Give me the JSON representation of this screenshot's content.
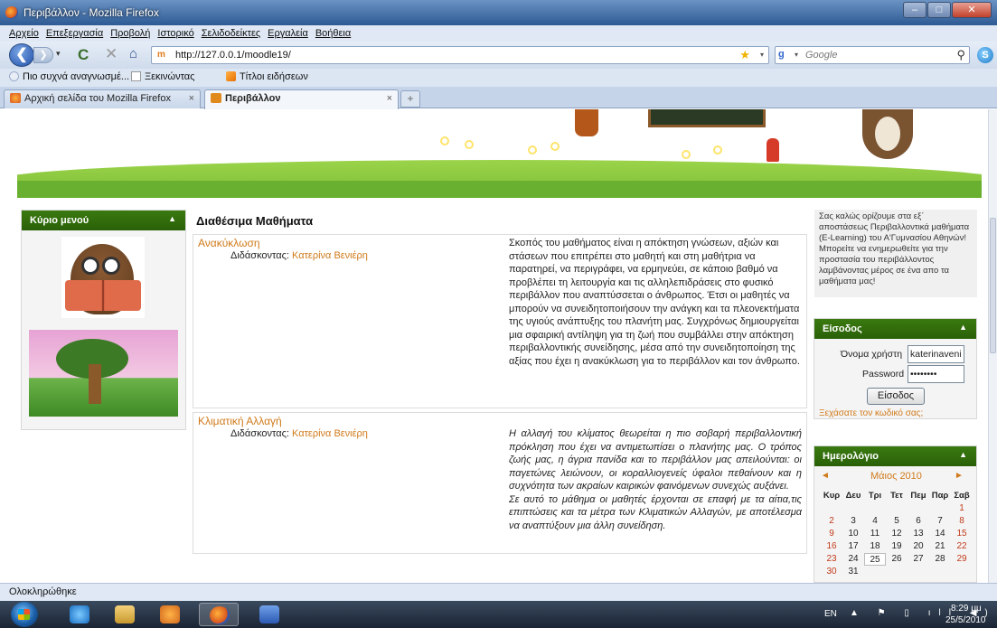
{
  "window": {
    "title": "Περιβάλλον - Mozilla Firefox",
    "buttons": {
      "minimize": "–",
      "maximize": "□",
      "close": "✕"
    }
  },
  "menu": [
    "Αρχείο",
    "Επεξεργασία",
    "Προβολή",
    "Ιστορικό",
    "Σελιδοδείκτες",
    "Εργαλεία",
    "Βοήθεια"
  ],
  "nav": {
    "back_glyph": "❮",
    "forward_glyph": "❯",
    "dropdown_glyph": "▾",
    "reload_glyph": "C",
    "stop_glyph": "✕",
    "home_glyph": "⌂",
    "url_favicon": "m",
    "url": "http://127.0.0.1/moodle19/",
    "star_glyph": "★",
    "url_dd_glyph": "▾",
    "search_engine_glyph": "g",
    "search_dd_glyph": "▾",
    "search_placeholder": "Google",
    "search_glyph": "⚲",
    "skype_glyph": "S"
  },
  "bookmarks": [
    "Πιο συχνά αναγνωσμέ...",
    "Ξεκινώντας",
    "Τίτλοι ειδήσεων"
  ],
  "tabs": [
    {
      "label": "Αρχική σελίδα του Mozilla Firefox",
      "close": "×"
    },
    {
      "label": "Περιβάλλον",
      "close": "×"
    }
  ],
  "new_tab_glyph": "+",
  "left_block": {
    "title": "Κύριο μενού",
    "collapse_glyph": "▲"
  },
  "main": {
    "title": "Διαθέσιμα Μαθήματα",
    "teacher_prefix": "Διδάσκοντας:",
    "courses": [
      {
        "name": "Ανακύκλωση",
        "teacher": "Κατερίνα Βενιέρη",
        "summary": "Σκοπός του μαθήματος είναι η απόκτηση γνώσεων, αξιών και στάσεων που επιτρέπει στο μαθητή και στη μαθήτρια να παρατηρεί, να περιγράφει, να ερμηνεύει, σε κάποιο βαθμό να προβλέπει τη λειτουργία και τις αλληλεπιδράσεις στο φυσικό περιβάλλον που αναπτύσσεται ο άνθρωπος. Έτσι οι μαθητές να μπορούν να συνειδητοποιήσουν την ανάγκη και τα πλεονεκτήματα της υγιούς ανάπτυξης του πλανήτη μας. Συγχρόνως δημιουργείται μια σφαιρική αντίληψη για τη ζωή που συμβάλλει στην απόκτηση περιβαλλοντικής συνείδησης, μέσα από την συνειδητοποίηση της αξίας που έχει η ανακύκλωση για το περιβάλλον και τον άνθρωπο."
      },
      {
        "name": "Κλιματική Αλλαγή",
        "teacher": "Κατερίνα Βενιέρη",
        "summary_p1": "Η αλλαγή του κλίματος θεωρείται η πιο σοβαρή περιβαλλοντική πρόκληση που έχει να αντιμετωπίσει ο πλανήτης μας. Ο τρόπος ζωής μας, η άγρια πανίδα και το περιβάλλον μας απειλούνται: οι παγετώνες λειώνουν, οι κοραλλιογενείς ύφαλοι πεθαίνουν και η συχνότητα των ακραίων καιρικών φαινόμενων συνεχώς αυξάνει.",
        "summary_p2": "Σε αυτό το μάθημα οι μαθητές έρχονται σε επαφή με τα αίτια,τις επιπτώσεις και τα μέτρα των Κλιματικών Αλλαγών, με αποτέλεσμα να αναπτύξουν μια άλλη συνείδηση."
      }
    ]
  },
  "welcome": "Σας καλώς ορίζουμε στα εξ΄ αποστάσεως Περιβαλλοντικά μαθήματα (E-Learning) του Α'Γυμνασίου Αθηνών! Μπορείτε να ενημερωθείτε για την προστασία του περιβάλλοντος λαμβάνοντας μέρος σε ένα απο τα μαθήματα μας!",
  "login": {
    "title": "Είσοδος",
    "collapse_glyph": "▲",
    "username_label": "Όνομα χρήστη",
    "username_value": "katerinaveni",
    "password_label": "Password",
    "password_value": "••••••••",
    "submit": "Είσοδος",
    "forgot": "Ξεχάσατε τον κωδικό σας;"
  },
  "calendar": {
    "title": "Ημερολόγιο",
    "collapse_glyph": "▲",
    "prev": "◄",
    "next": "►",
    "month": "Μάιος 2010",
    "weekdays": [
      "Κυρ",
      "Δευ",
      "Τρι",
      "Τετ",
      "Πεμ",
      "Παρ",
      "Σαβ"
    ],
    "weeks": [
      [
        "",
        "",
        "",
        "",
        "",
        "",
        "1"
      ],
      [
        "2",
        "3",
        "4",
        "5",
        "6",
        "7",
        "8"
      ],
      [
        "9",
        "10",
        "11",
        "12",
        "13",
        "14",
        "15"
      ],
      [
        "16",
        "17",
        "18",
        "19",
        "20",
        "21",
        "22"
      ],
      [
        "23",
        "24",
        "25",
        "26",
        "27",
        "28",
        "29"
      ],
      [
        "30",
        "31",
        "",
        "",
        "",
        "",
        ""
      ]
    ],
    "today": "25"
  },
  "status": "Ολοκληρώθηκε",
  "taskbar": {
    "language": "EN",
    "tray_glyphs": "▲ ⚑ ▯ ıll ◀)",
    "time": "8:29 μμ",
    "date": "25/5/2010"
  },
  "colors": {
    "link_orange": "#d07a1a",
    "block_green": "#2a6008",
    "banner_green": "#6ab030",
    "weekend_red": "#c23a1a"
  }
}
